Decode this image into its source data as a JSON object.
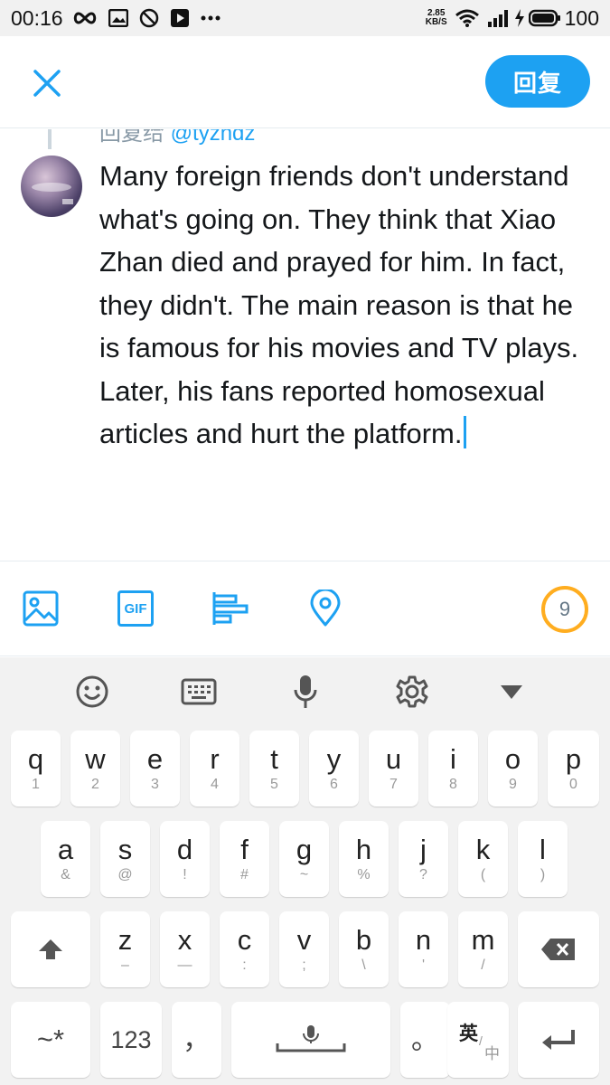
{
  "status_bar": {
    "time": "00:16",
    "net_speed_value": "2.85",
    "net_speed_unit": "KB/S",
    "battery": "100"
  },
  "header": {
    "close_icon": "close-icon",
    "reply_label": "回复"
  },
  "compose": {
    "reply_to_prefix": "回复给",
    "reply_to_handle": "@tyzhdz",
    "text": "Many foreign friends don't understand what's going on. They think that Xiao Zhan died and prayed for him. In fact, they didn't. The main reason is that he is famous for his movies and TV plays. Later, his fans reported homosexual articles and hurt the platform."
  },
  "toolbar": {
    "icons": [
      "image-icon",
      "gif-icon",
      "poll-icon",
      "location-icon"
    ],
    "gif_label": "GIF",
    "char_counter": "9"
  },
  "keyboard": {
    "row1": [
      {
        "main": "q",
        "sub": "1"
      },
      {
        "main": "w",
        "sub": "2"
      },
      {
        "main": "e",
        "sub": "3"
      },
      {
        "main": "r",
        "sub": "4"
      },
      {
        "main": "t",
        "sub": "5"
      },
      {
        "main": "y",
        "sub": "6"
      },
      {
        "main": "u",
        "sub": "7"
      },
      {
        "main": "i",
        "sub": "8"
      },
      {
        "main": "o",
        "sub": "9"
      },
      {
        "main": "p",
        "sub": "0"
      }
    ],
    "row2": [
      {
        "main": "a",
        "sub": "&"
      },
      {
        "main": "s",
        "sub": "@"
      },
      {
        "main": "d",
        "sub": "!"
      },
      {
        "main": "f",
        "sub": "#"
      },
      {
        "main": "g",
        "sub": "~"
      },
      {
        "main": "h",
        "sub": "%"
      },
      {
        "main": "j",
        "sub": "?"
      },
      {
        "main": "k",
        "sub": "("
      },
      {
        "main": "l",
        "sub": ")"
      }
    ],
    "row3": [
      {
        "main": "z",
        "sub": "–"
      },
      {
        "main": "x",
        "sub": "—"
      },
      {
        "main": "c",
        "sub": ":"
      },
      {
        "main": "v",
        "sub": ";"
      },
      {
        "main": "b",
        "sub": "\\"
      },
      {
        "main": "n",
        "sub": "'"
      },
      {
        "main": "m",
        "sub": "/"
      }
    ],
    "symbols_key": "~*",
    "numbers_key": "123",
    "comma_key": "，",
    "period_key": "。",
    "lang_key_main": "英",
    "lang_key_sub": "中"
  }
}
